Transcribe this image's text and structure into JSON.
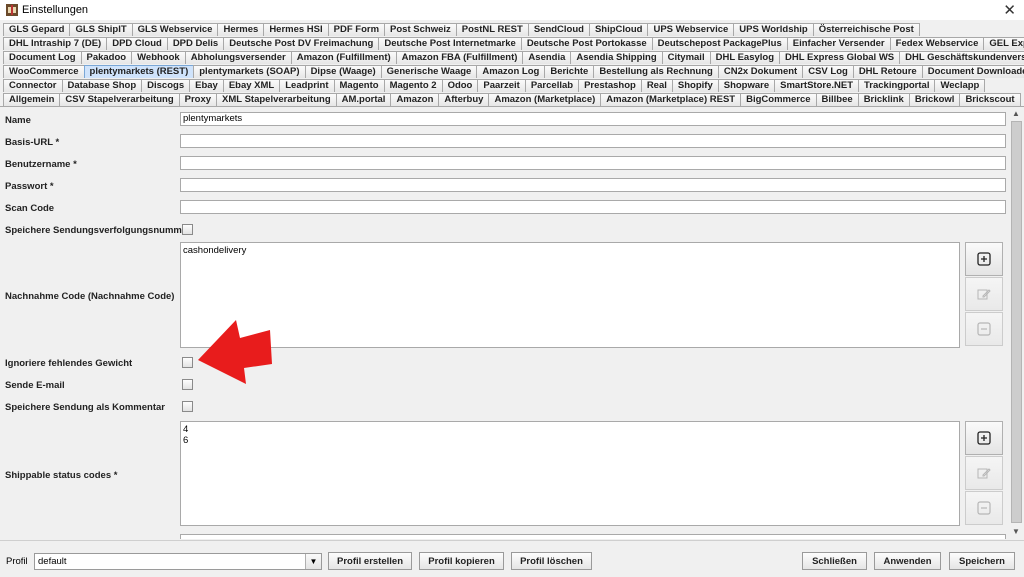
{
  "window": {
    "title": "Einstellungen",
    "close_label": "✕"
  },
  "tabs": {
    "rows": [
      [
        "GLS Gepard",
        "GLS ShipIT",
        "GLS Webservice",
        "Hermes",
        "Hermes HSI",
        "PDF Form",
        "Post Schweiz",
        "PostNL REST",
        "SendCloud",
        "ShipCloud",
        "UPS Webservice",
        "UPS Worldship",
        "Österreichische Post"
      ],
      [
        "DHL Intraship 7 (DE)",
        "DPD Cloud",
        "DPD Delis",
        "Deutsche Post DV Freimachung",
        "Deutsche Post Internetmarke",
        "Deutsche Post Portokasse",
        "Deutschepost PackagePlus",
        "Einfacher Versender",
        "Fedex Webservice",
        "GEL Express"
      ],
      [
        "Document Log",
        "Pakadoo",
        "Webhook",
        "Abholungsversender",
        "Amazon (Fulfillment)",
        "Amazon FBA (Fulfillment)",
        "Asendia",
        "Asendia Shipping",
        "Citymail",
        "DHL Easylog",
        "DHL Express Global WS",
        "DHL Geschäftskundenversand"
      ],
      [
        "WooCommerce",
        "plentymarkets (REST)",
        "plentymarkets (SOAP)",
        "Dipse (Waage)",
        "Generische Waage",
        "Amazon Log",
        "Berichte",
        "Bestellung als Rechnung",
        "CN2x Dokument",
        "CSV Log",
        "DHL Retoure",
        "Document Downloader"
      ],
      [
        "Connector",
        "Database Shop",
        "Discogs",
        "Ebay",
        "Ebay XML",
        "Leadprint",
        "Magento",
        "Magento 2",
        "Odoo",
        "Paarzeit",
        "Parcellab",
        "Prestashop",
        "Real",
        "Shopify",
        "Shopware",
        "SmartStore.NET",
        "Trackingportal",
        "Weclapp"
      ],
      [
        "Allgemein",
        "CSV Stapelverarbeitung",
        "Proxy",
        "XML Stapelverarbeitung",
        "AM.portal",
        "Amazon",
        "Afterbuy",
        "Amazon (Marketplace)",
        "Amazon (Marketplace) REST",
        "BigCommerce",
        "Billbee",
        "Bricklink",
        "Brickowl",
        "Brickscout"
      ]
    ],
    "active": "plentymarkets (REST)"
  },
  "form": {
    "name_label": "Name",
    "name_value": "plentymarkets",
    "baseurl_label": "Basis-URL *",
    "baseurl_value": "",
    "username_label": "Benutzername *",
    "username_value": "",
    "password_label": "Passwort *",
    "password_value": "",
    "scancode_label": "Scan Code",
    "scancode_value": "",
    "save_tracking_label": "Speichere Sendungsverfolgungsnummer",
    "cod_label": "Nachnahme Code (Nachnahme Code)",
    "cod_values": [
      "cashondelivery"
    ],
    "ignore_weight_label": "Ignoriere fehlendes Gewicht",
    "send_email_label": "Sende E-mail",
    "save_comment_label": "Speichere Sendung als Kommentar",
    "shippable_label": "Shippable status codes *",
    "shippable_values": [
      "4",
      "6"
    ]
  },
  "footer": {
    "profile_label": "Profil",
    "profile_value": "default",
    "create_label": "Profil erstellen",
    "copy_label": "Profil kopieren",
    "delete_label": "Profil löschen",
    "close_label": "Schließen",
    "apply_label": "Anwenden",
    "save_label": "Speichern"
  },
  "colors": {
    "active_tab": "#cfe3fb",
    "annotation_arrow": "#e81c1c"
  },
  "icons": {
    "add": "plus-square-icon",
    "edit": "edit-icon",
    "remove": "minus-square-icon"
  }
}
